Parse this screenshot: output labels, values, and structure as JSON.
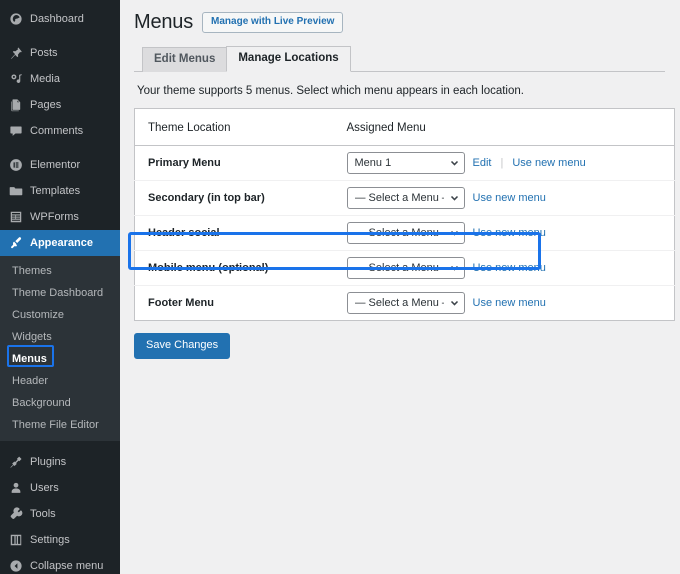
{
  "sidebar": {
    "items": [
      {
        "label": "Dashboard",
        "icon": "dashboard-icon",
        "active": false,
        "gap_after": true
      },
      {
        "label": "Posts",
        "icon": "pin-icon",
        "active": false,
        "gap_after": false
      },
      {
        "label": "Media",
        "icon": "media-icon",
        "active": false,
        "gap_after": false
      },
      {
        "label": "Pages",
        "icon": "pages-icon",
        "active": false,
        "gap_after": false
      },
      {
        "label": "Comments",
        "icon": "comments-icon",
        "active": false,
        "gap_after": true
      },
      {
        "label": "Elementor",
        "icon": "elementor-icon",
        "active": false,
        "gap_after": false
      },
      {
        "label": "Templates",
        "icon": "folder-icon",
        "active": false,
        "gap_after": false
      },
      {
        "label": "WPForms",
        "icon": "wpforms-icon",
        "active": false,
        "gap_after": false
      },
      {
        "label": "Appearance",
        "icon": "paintbrush-icon",
        "active": true,
        "gap_after": false
      }
    ],
    "submenu": [
      {
        "label": "Themes",
        "current": false
      },
      {
        "label": "Theme Dashboard",
        "current": false
      },
      {
        "label": "Customize",
        "current": false
      },
      {
        "label": "Widgets",
        "current": false
      },
      {
        "label": "Menus",
        "current": true
      },
      {
        "label": "Header",
        "current": false
      },
      {
        "label": "Background",
        "current": false
      },
      {
        "label": "Theme File Editor",
        "current": false
      }
    ],
    "items_bottom": [
      {
        "label": "Plugins",
        "icon": "plug-icon"
      },
      {
        "label": "Users",
        "icon": "user-icon"
      },
      {
        "label": "Tools",
        "icon": "wrench-icon"
      },
      {
        "label": "Settings",
        "icon": "settings-icon"
      },
      {
        "label": "Collapse menu",
        "icon": "collapse-icon"
      }
    ]
  },
  "header": {
    "title": "Menus",
    "live_preview_label": "Manage with Live Preview"
  },
  "tabs": [
    {
      "label": "Edit Menus",
      "active": false
    },
    {
      "label": "Manage Locations",
      "active": true
    }
  ],
  "intro_text": "Your theme supports 5 menus. Select which menu appears in each location.",
  "table": {
    "columns": [
      "Theme Location",
      "Assigned Menu"
    ],
    "rows": [
      {
        "location": "Primary Menu",
        "selected": "Menu 1",
        "links": [
          "Edit",
          "Use new menu"
        ],
        "has_separator": true,
        "highlighted": false
      },
      {
        "location": "Secondary (in top bar)",
        "selected": "— Select a Menu —",
        "links": [
          "Use new menu"
        ],
        "has_separator": false,
        "highlighted": false
      },
      {
        "location": "Header social",
        "selected": "— Select a Menu —",
        "links": [
          "Use new menu"
        ],
        "has_separator": false,
        "highlighted": false
      },
      {
        "location": "Mobile menu (optional)",
        "selected": "— Select a Menu —",
        "links": [
          "Use new menu"
        ],
        "has_separator": false,
        "highlighted": true
      },
      {
        "location": "Footer Menu",
        "selected": "— Select a Menu —",
        "links": [
          "Use new menu"
        ],
        "has_separator": false,
        "highlighted": false
      }
    ]
  },
  "save_label": "Save Changes",
  "colors": {
    "accent": "#2271b1",
    "annotation": "#1a73ea",
    "sidebar_bg": "#1d2327",
    "submenu_bg": "#2c3338",
    "page_bg": "#f0f0f1"
  }
}
